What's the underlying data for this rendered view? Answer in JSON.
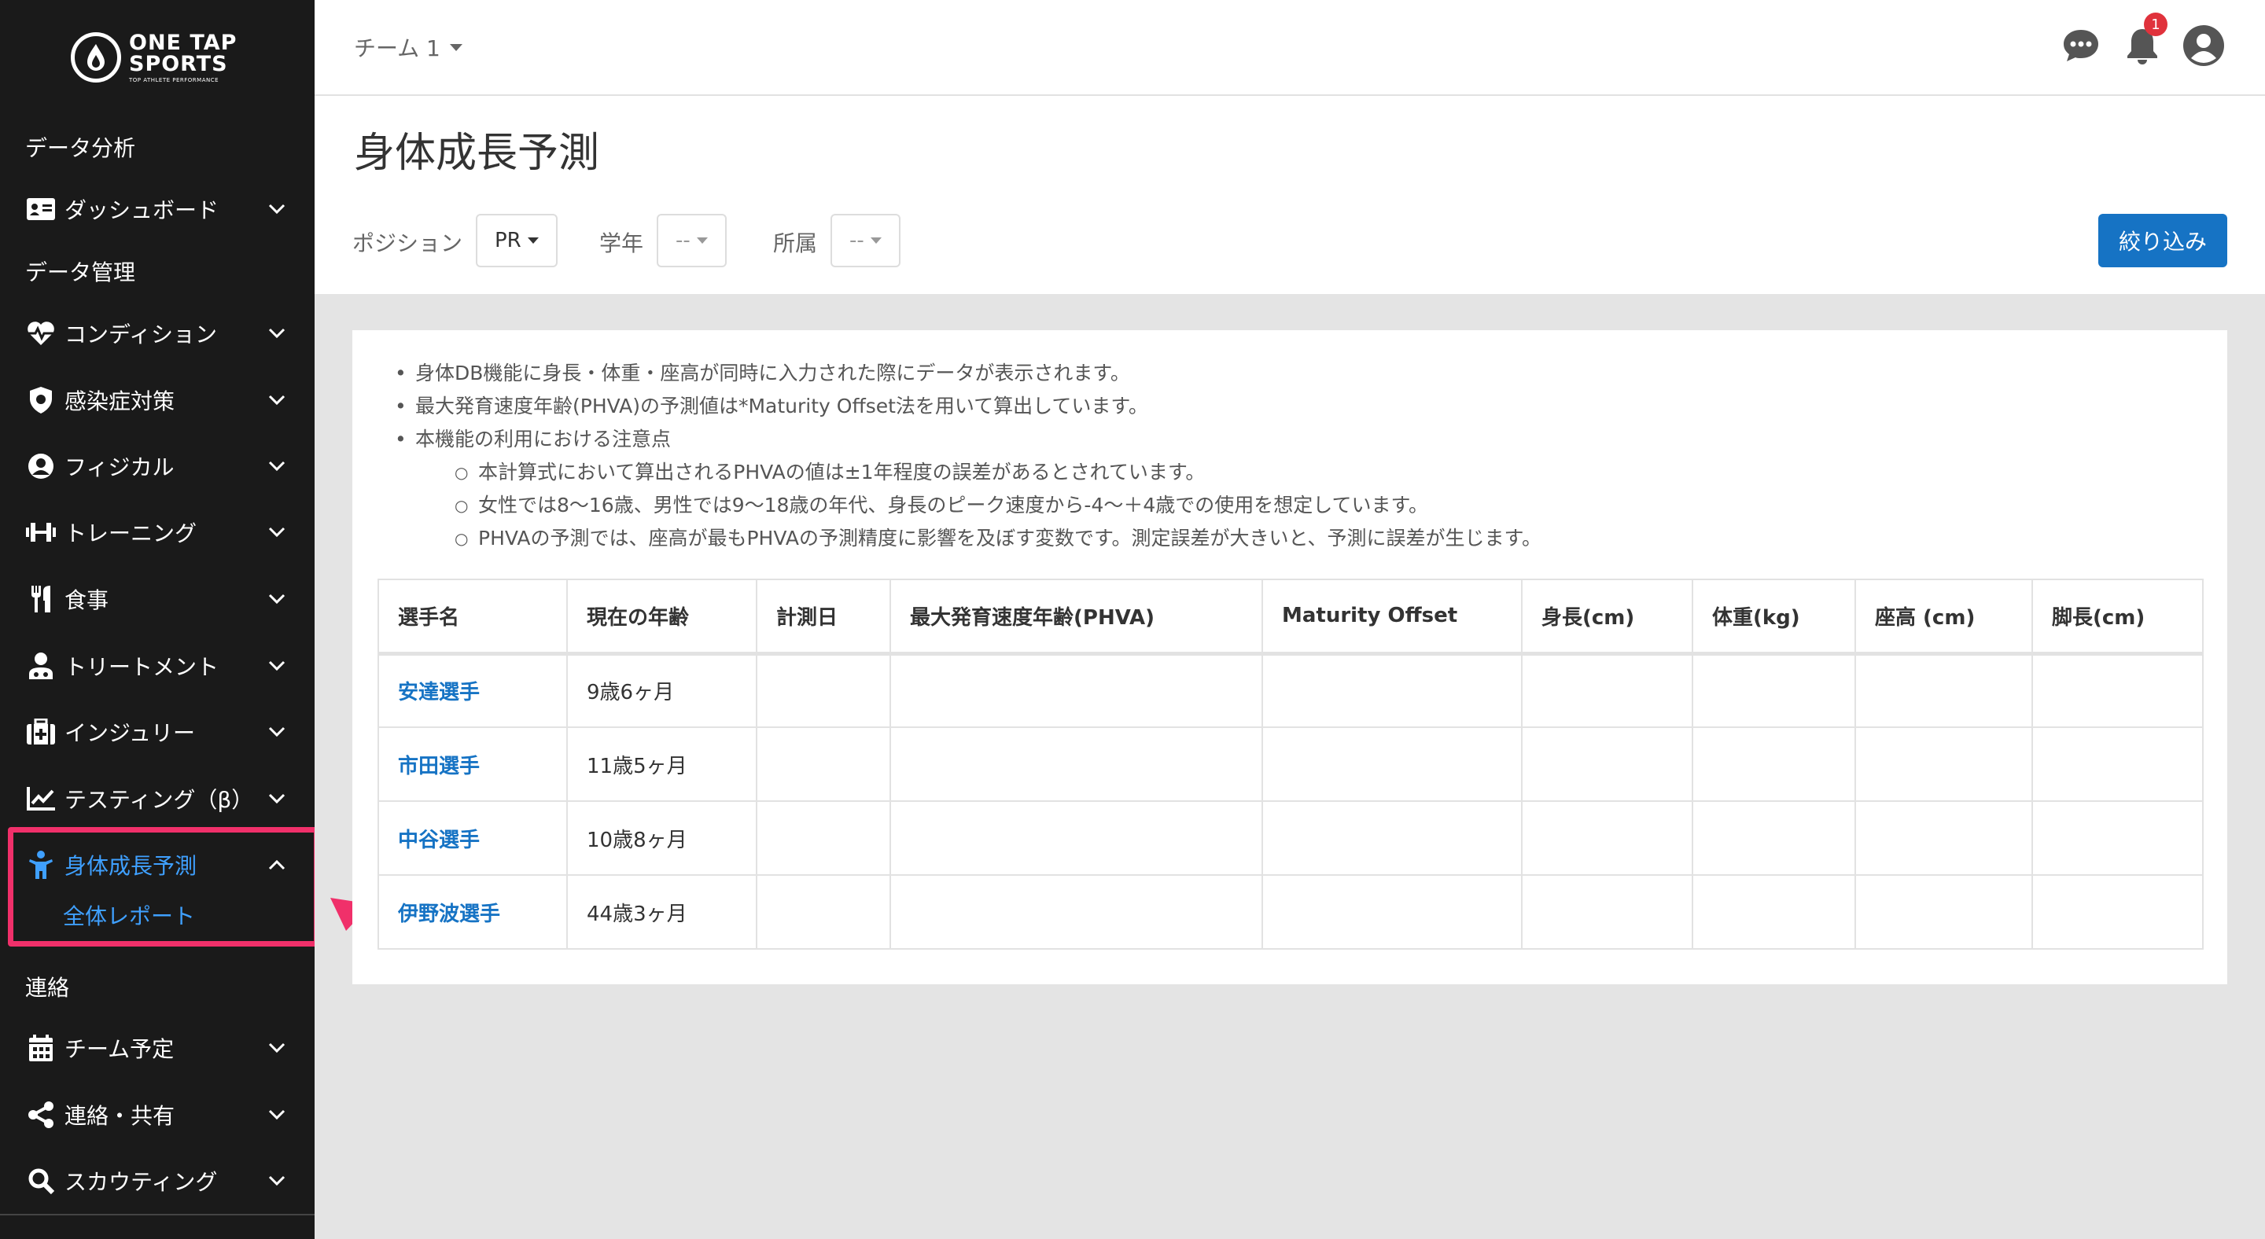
{
  "brand": {
    "line1": "ONE TAP",
    "line2": "SPORTS",
    "line3": "TOP ATHLETE PERFORMANCE"
  },
  "sidebar": {
    "sections": {
      "analysis": "データ分析",
      "management": "データ管理",
      "contact": "連絡"
    },
    "items": [
      {
        "label": "ダッシュボード",
        "icon": "id-card-icon"
      },
      {
        "label": "コンディション",
        "icon": "heartbeat-icon"
      },
      {
        "label": "感染症対策",
        "icon": "shield-virus-icon"
      },
      {
        "label": "フィジカル",
        "icon": "user-circle-icon"
      },
      {
        "label": "トレーニング",
        "icon": "dumbbell-icon"
      },
      {
        "label": "食事",
        "icon": "utensils-icon"
      },
      {
        "label": "トリートメント",
        "icon": "user-treatment-icon"
      },
      {
        "label": "インジュリー",
        "icon": "first-aid-icon"
      },
      {
        "label": "テスティング（β）",
        "icon": "chart-line-icon"
      },
      {
        "label": "身体成長予測",
        "icon": "child-growth-icon",
        "active": true
      },
      {
        "label": "チーム予定",
        "icon": "calendar-icon"
      },
      {
        "label": "連絡・共有",
        "icon": "share-icon"
      },
      {
        "label": "スカウティング",
        "icon": "search-icon"
      }
    ],
    "sub_item": "全体レポート"
  },
  "topbar": {
    "team": "チーム 1",
    "notification_count": "1"
  },
  "page": {
    "title": "身体成長予測",
    "filters": [
      {
        "label": "ポジション",
        "value": "PR"
      },
      {
        "label": "学年",
        "value": "--"
      },
      {
        "label": "所属",
        "value": "--"
      }
    ],
    "filter_button": "絞り込み"
  },
  "notes": {
    "top": [
      "身体DB機能に身長・体重・座高が同時に入力された際にデータが表示されます。",
      "最大発育速度年齢(PHVA)の予測値は*Maturity Offset法を用いて算出しています。",
      "本機能の利用における注意点"
    ],
    "sub": [
      "本計算式において算出されるPHVAの値は±1年程度の誤差があるとされています。",
      "女性では8〜16歳、男性では9〜18歳の年代、身長のピーク速度から-4〜＋4歳での使用を想定しています。",
      "PHVAの予測では、座高が最もPHVAの予測精度に影響を及ぼす変数です。測定誤差が大きいと、予測に誤差が生じます。"
    ]
  },
  "table": {
    "headers": [
      "選手名",
      "現在の年齢",
      "計測日",
      "最大発育速度年齢(PHVA)",
      "Maturity Offset",
      "身長(cm)",
      "体重(kg)",
      "座高 (cm)",
      "脚長(cm)"
    ],
    "rows": [
      {
        "name": "安達選手",
        "age": "9歳6ヶ月"
      },
      {
        "name": "市田選手",
        "age": "11歳5ヶ月"
      },
      {
        "name": "中谷選手",
        "age": "10歳8ヶ月"
      },
      {
        "name": "伊野波選手",
        "age": "44歳3ヶ月"
      }
    ]
  },
  "colors": {
    "sidebar_bg": "#1a1a1a",
    "accent": "#1673c4",
    "active_nav": "#3fa0ff",
    "highlight": "#f0306a",
    "badge": "#e0323c"
  }
}
